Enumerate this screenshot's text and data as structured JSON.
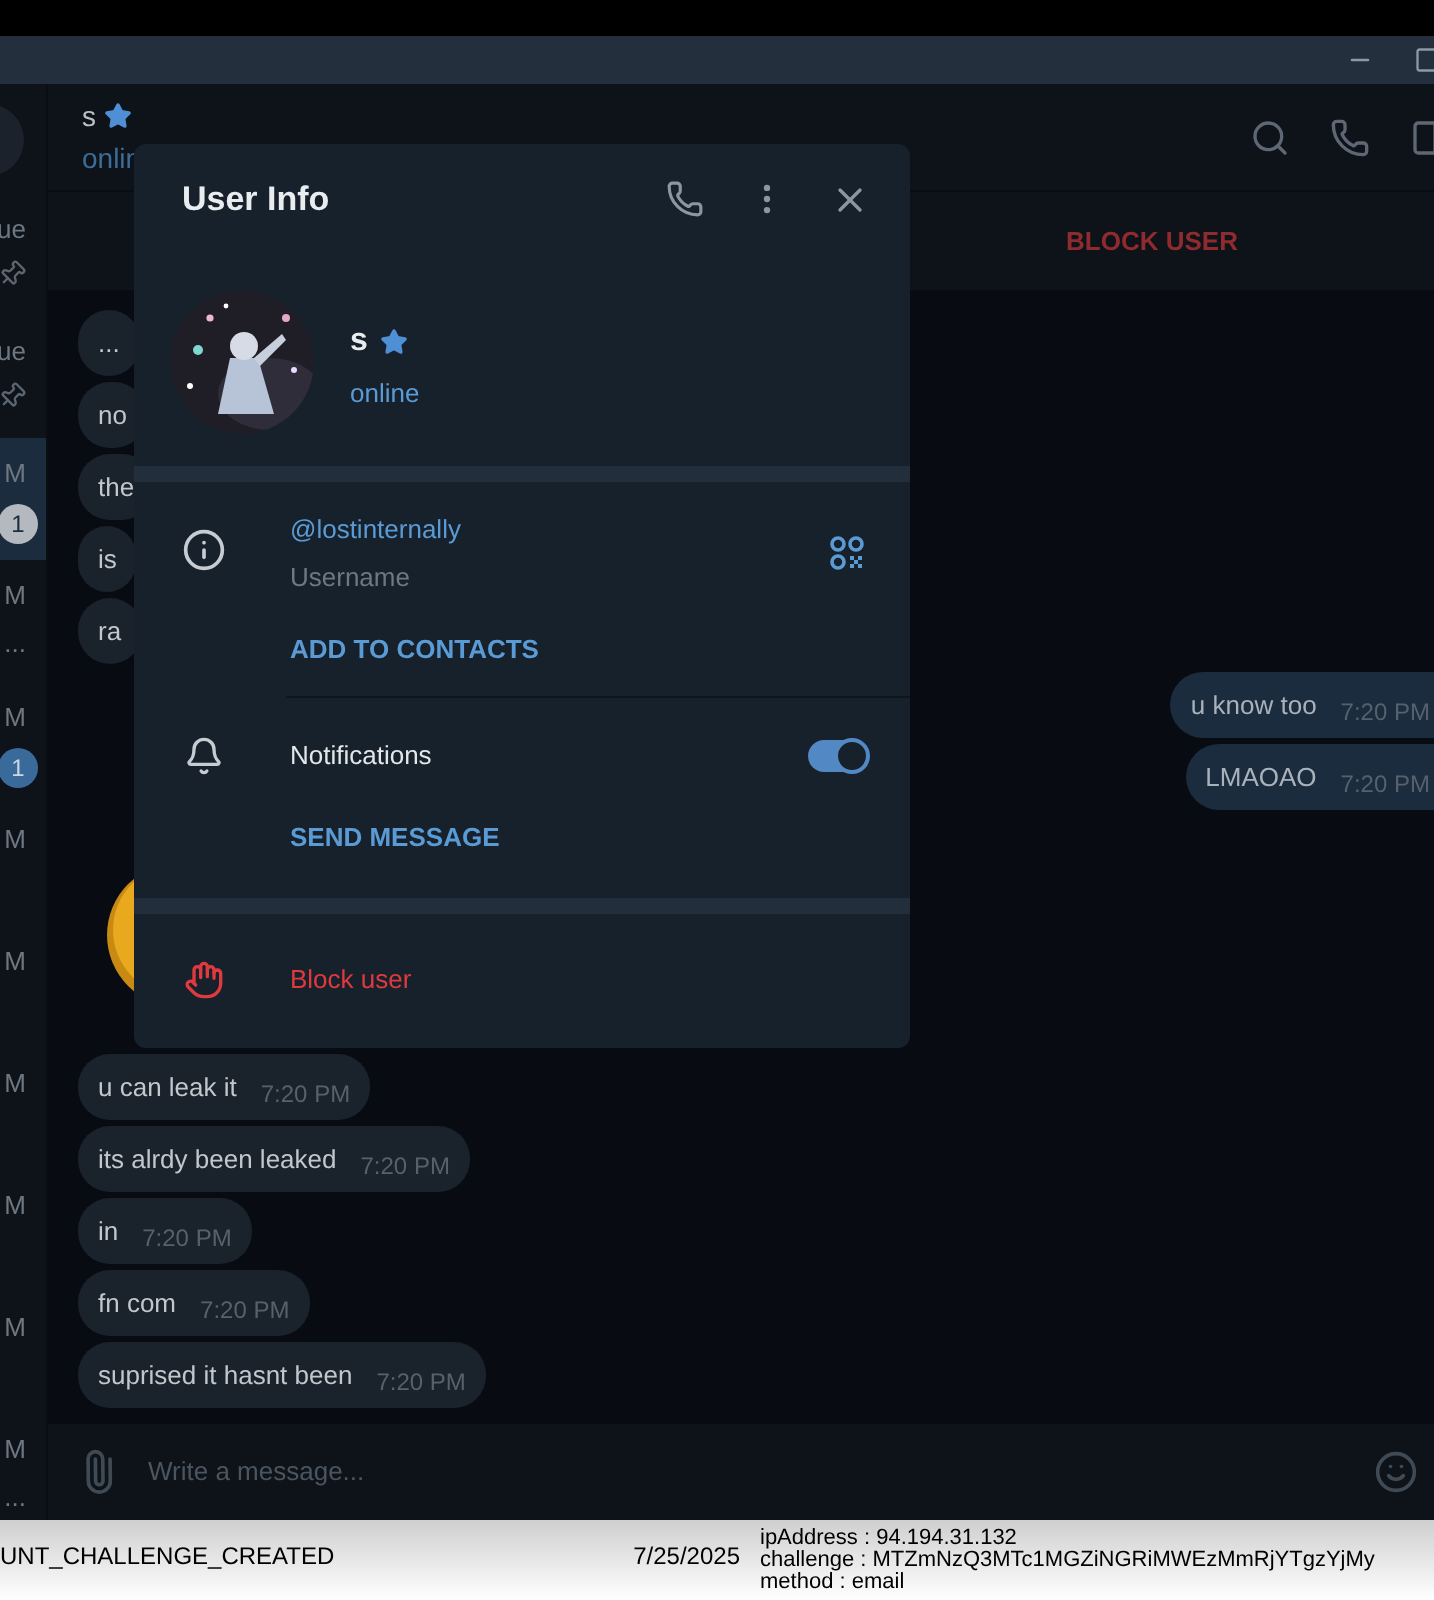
{
  "chat_header": {
    "name": "s",
    "starred": true,
    "status": "onlin"
  },
  "pinned_bar": {
    "action": "BLOCK USER"
  },
  "sidebar": {
    "items": [
      {
        "time": "ue",
        "pinned": true,
        "selected": false
      },
      {
        "time": "ue",
        "pinned": true,
        "selected": false
      },
      {
        "time": "M",
        "badge": "1",
        "muted": true,
        "selected": true
      },
      {
        "time": "M",
        "preview": "...",
        "selected": false
      },
      {
        "time": "M",
        "badge": "1",
        "muted": false,
        "selected": false
      },
      {
        "time": "M",
        "selected": false
      },
      {
        "time": "M",
        "selected": false
      },
      {
        "time": "M",
        "selected": false
      },
      {
        "time": "M",
        "selected": false
      },
      {
        "time": "M",
        "selected": false
      },
      {
        "time": "M",
        "preview": "...",
        "selected": false
      }
    ]
  },
  "messages": [
    {
      "kind": "text",
      "outgoing": false,
      "text": "..."
    },
    {
      "kind": "text",
      "outgoing": false,
      "text": "no"
    },
    {
      "kind": "text",
      "outgoing": false,
      "text": "the"
    },
    {
      "kind": "text",
      "outgoing": false,
      "text": "is"
    },
    {
      "kind": "text",
      "outgoing": false,
      "text": "ra"
    },
    {
      "kind": "text",
      "outgoing": true,
      "text": "u know too",
      "time": "7:20 PM"
    },
    {
      "kind": "text",
      "outgoing": true,
      "text": "LMAOAO",
      "time": "7:20 PM"
    },
    {
      "kind": "sticker"
    },
    {
      "kind": "text",
      "outgoing": false,
      "text": "u can leak it",
      "time": "7:20 PM"
    },
    {
      "kind": "text",
      "outgoing": false,
      "text": "its alrdy been leaked",
      "time": "7:20 PM"
    },
    {
      "kind": "text",
      "outgoing": false,
      "text": "in",
      "time": "7:20 PM"
    },
    {
      "kind": "text",
      "outgoing": false,
      "text": "fn com",
      "time": "7:20 PM"
    },
    {
      "kind": "text",
      "outgoing": false,
      "text": "suprised it hasnt been",
      "time": "7:20 PM"
    }
  ],
  "composer": {
    "placeholder": "Write a message..."
  },
  "user_info": {
    "title": "User Info",
    "name": "s",
    "starred": true,
    "status": "online",
    "username": "@lostinternally",
    "username_label": "Username",
    "add_contact": "ADD TO CONTACTS",
    "notifications": {
      "label": "Notifications",
      "on": true
    },
    "send_message": "SEND MESSAGE",
    "block": "Block user"
  },
  "log": {
    "event": "UNT_CHALLENGE_CREATED",
    "date": "7/25/2025",
    "details": [
      "ipAddress : 94.194.31.132",
      "challenge : MTZmNzQ3MTc1MGZiNGRiMWEzMmRjYTgzYjMy",
      "method : email"
    ]
  }
}
